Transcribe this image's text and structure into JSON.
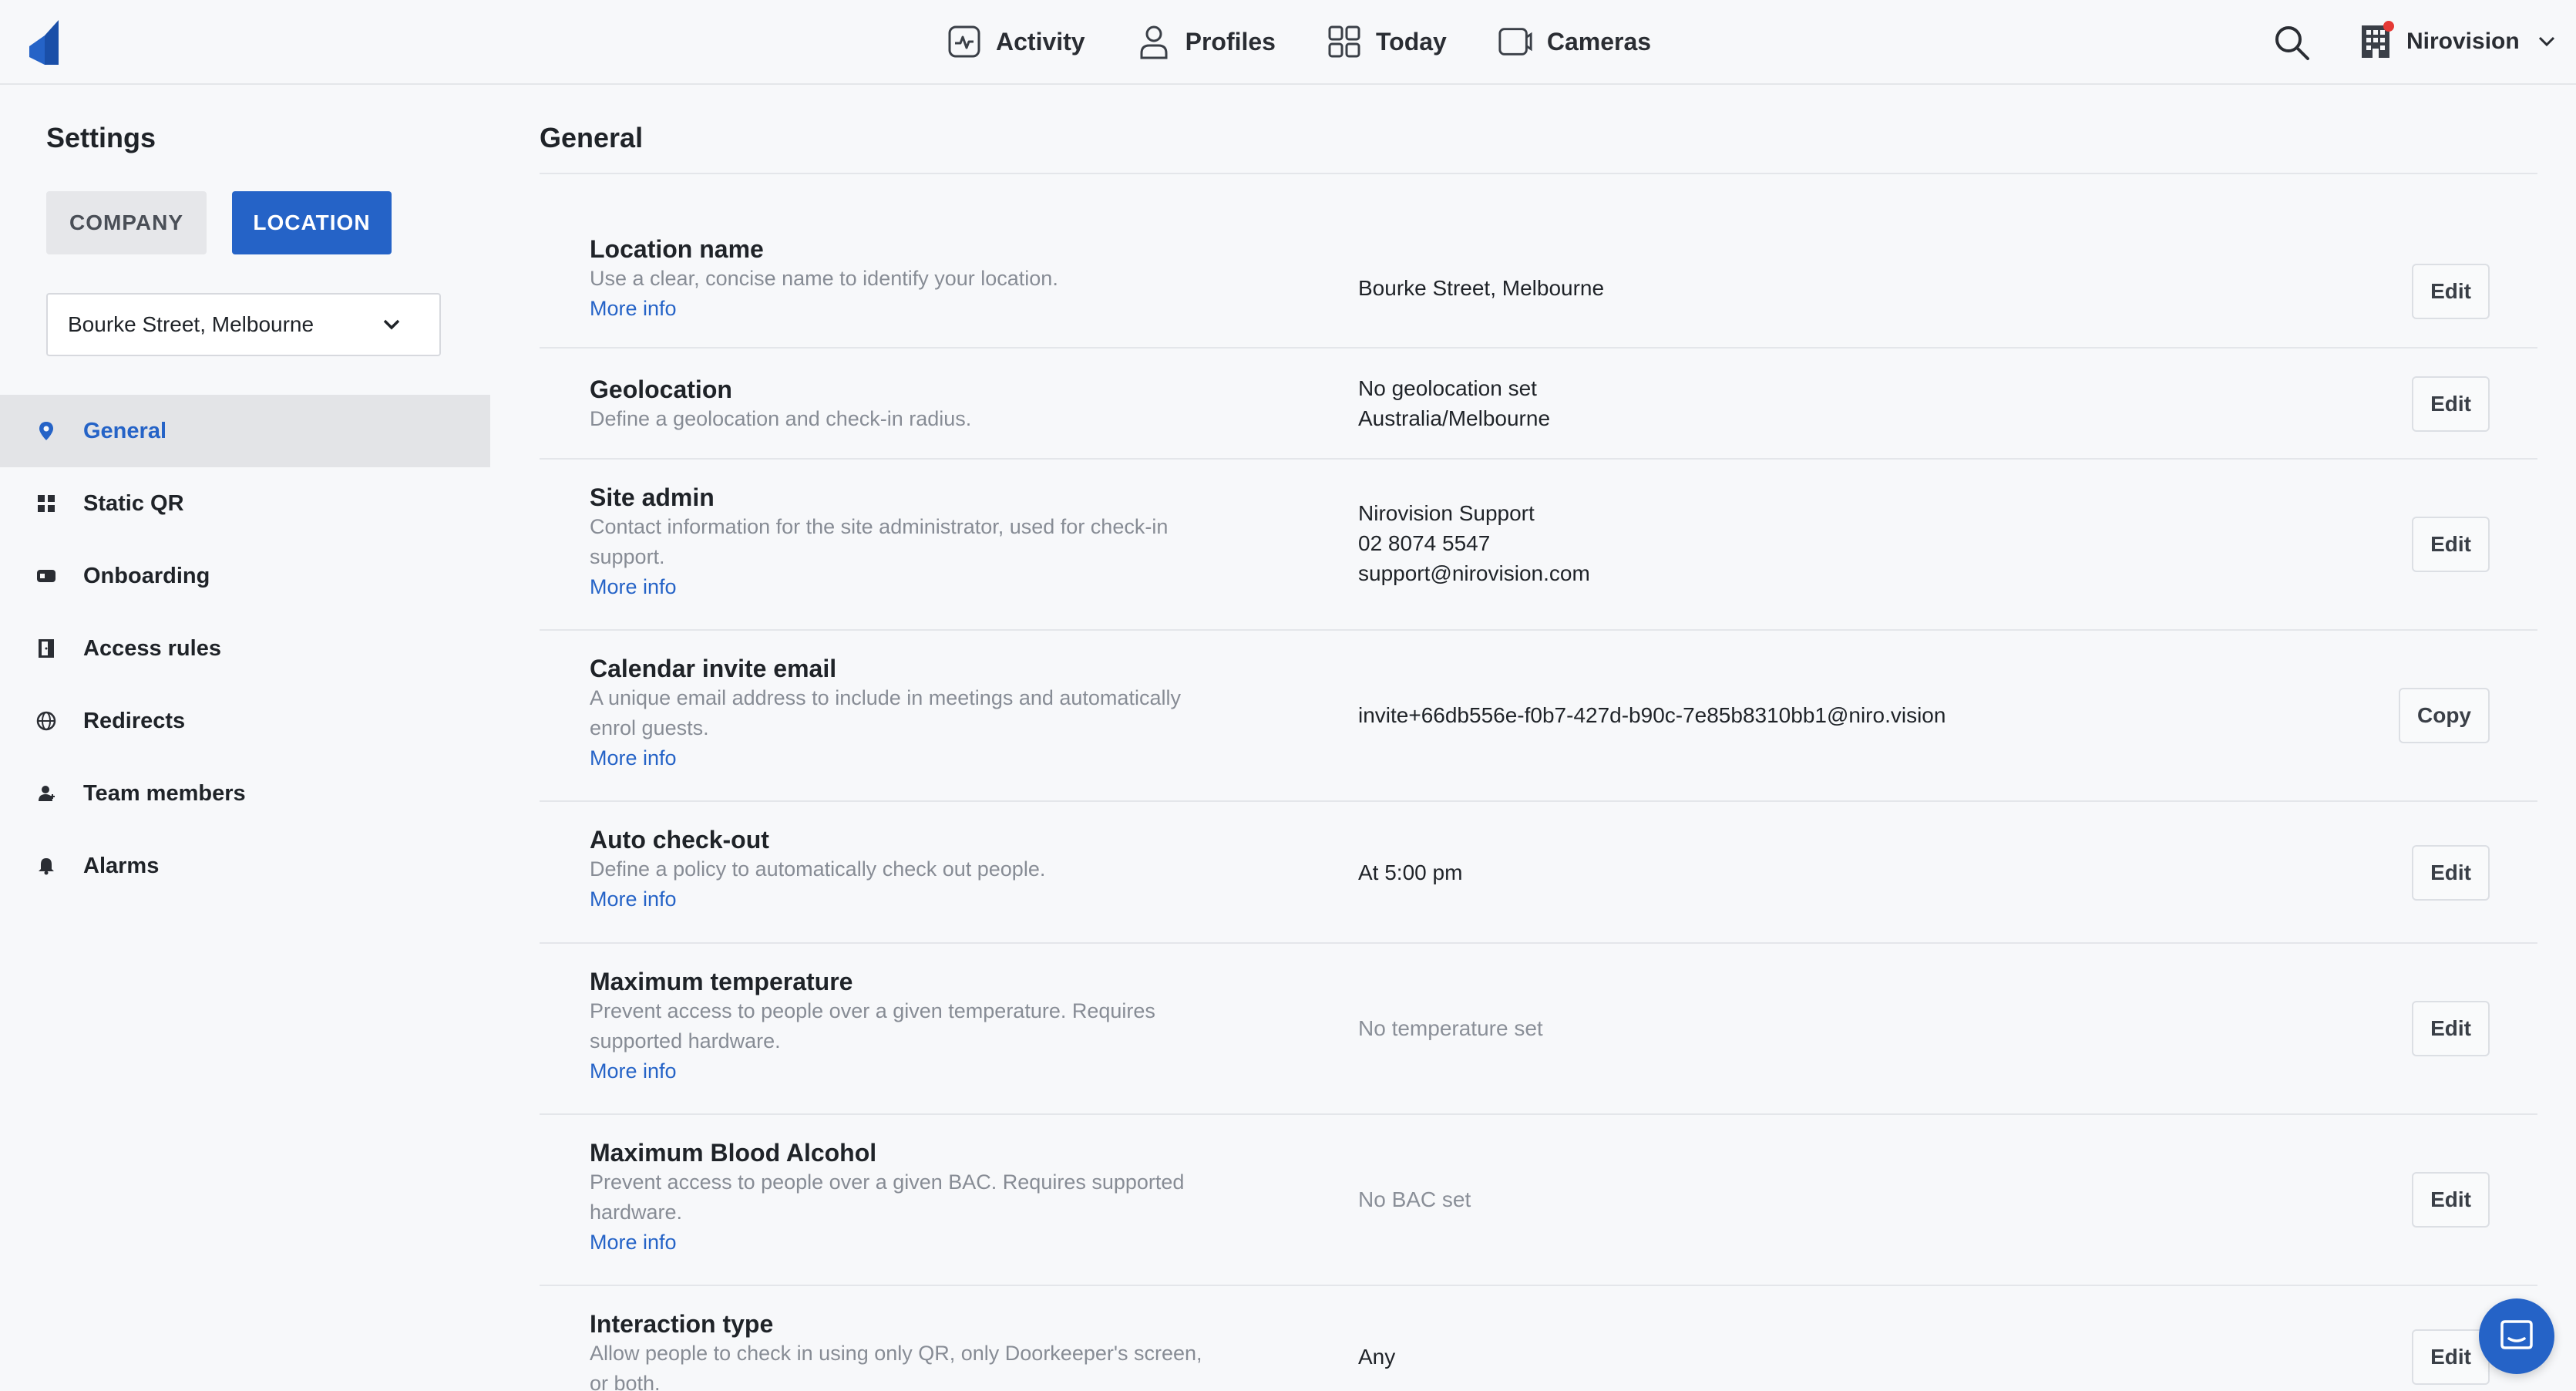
{
  "colors": {
    "accent": "#2563c7",
    "notification_dot": "#e53935"
  },
  "nav": [
    {
      "label": "Activity",
      "icon": "activity-icon"
    },
    {
      "label": "Profiles",
      "icon": "profile-icon"
    },
    {
      "label": "Today",
      "icon": "grid-icon"
    },
    {
      "label": "Cameras",
      "icon": "camera-icon"
    }
  ],
  "org": {
    "name": "Nirovision"
  },
  "sidebar": {
    "title": "Settings",
    "tabs": {
      "company": "COMPANY",
      "location": "LOCATION"
    },
    "location_select": {
      "value": "Bourke Street, Melbourne"
    },
    "items": [
      {
        "label": "General",
        "icon": "pin-icon",
        "active": true
      },
      {
        "label": "Static QR",
        "icon": "qr-icon"
      },
      {
        "label": "Onboarding",
        "icon": "onboarding-icon"
      },
      {
        "label": "Access rules",
        "icon": "door-icon"
      },
      {
        "label": "Redirects",
        "icon": "globe-icon"
      },
      {
        "label": "Team members",
        "icon": "team-icon"
      },
      {
        "label": "Alarms",
        "icon": "bell-icon"
      }
    ]
  },
  "main": {
    "title": "General",
    "rows": [
      {
        "name": "Location name",
        "desc": [
          "Use a clear, concise name to identify your location."
        ],
        "more": "More info",
        "values": [
          "Bourke Street, Melbourne"
        ],
        "button": "Edit"
      },
      {
        "name": "Geolocation",
        "desc": [
          "Define a geolocation and check-in radius."
        ],
        "values": [
          "No geolocation set",
          "Australia/Melbourne"
        ],
        "button": "Edit"
      },
      {
        "name": "Site admin",
        "desc": [
          "Contact information for the site administrator, used for check-in",
          "support."
        ],
        "more": "More info",
        "values": [
          "Nirovision Support",
          "02 8074 5547",
          "support@nirovision.com"
        ],
        "button": "Edit"
      },
      {
        "name": "Calendar invite email",
        "desc": [
          "A unique email address to include in meetings and automatically",
          "enrol guests."
        ],
        "more": "More info",
        "values": [
          "invite+66db556e-f0b7-427d-b90c-7e85b8310bb1@niro.vision"
        ],
        "button": "Copy"
      },
      {
        "name": "Auto check-out",
        "desc": [
          "Define a policy to automatically check out people."
        ],
        "more": "More info",
        "values": [
          "At 5:00 pm"
        ],
        "button": "Edit"
      },
      {
        "name": "Maximum temperature",
        "desc": [
          "Prevent access to people over a given temperature. Requires",
          "supported hardware."
        ],
        "more": "More info",
        "values": [
          "No temperature set"
        ],
        "muted": true,
        "button": "Edit"
      },
      {
        "name": "Maximum Blood Alcohol",
        "desc": [
          "Prevent access to people over a given BAC. Requires supported",
          "hardware."
        ],
        "more": "More info",
        "values": [
          "No BAC set"
        ],
        "muted": true,
        "button": "Edit"
      },
      {
        "name": "Interaction type",
        "desc": [
          "Allow people to check in using only QR, only Doorkeeper's screen,",
          "or both."
        ],
        "values": [
          "Any"
        ],
        "button": "Edit"
      }
    ]
  }
}
